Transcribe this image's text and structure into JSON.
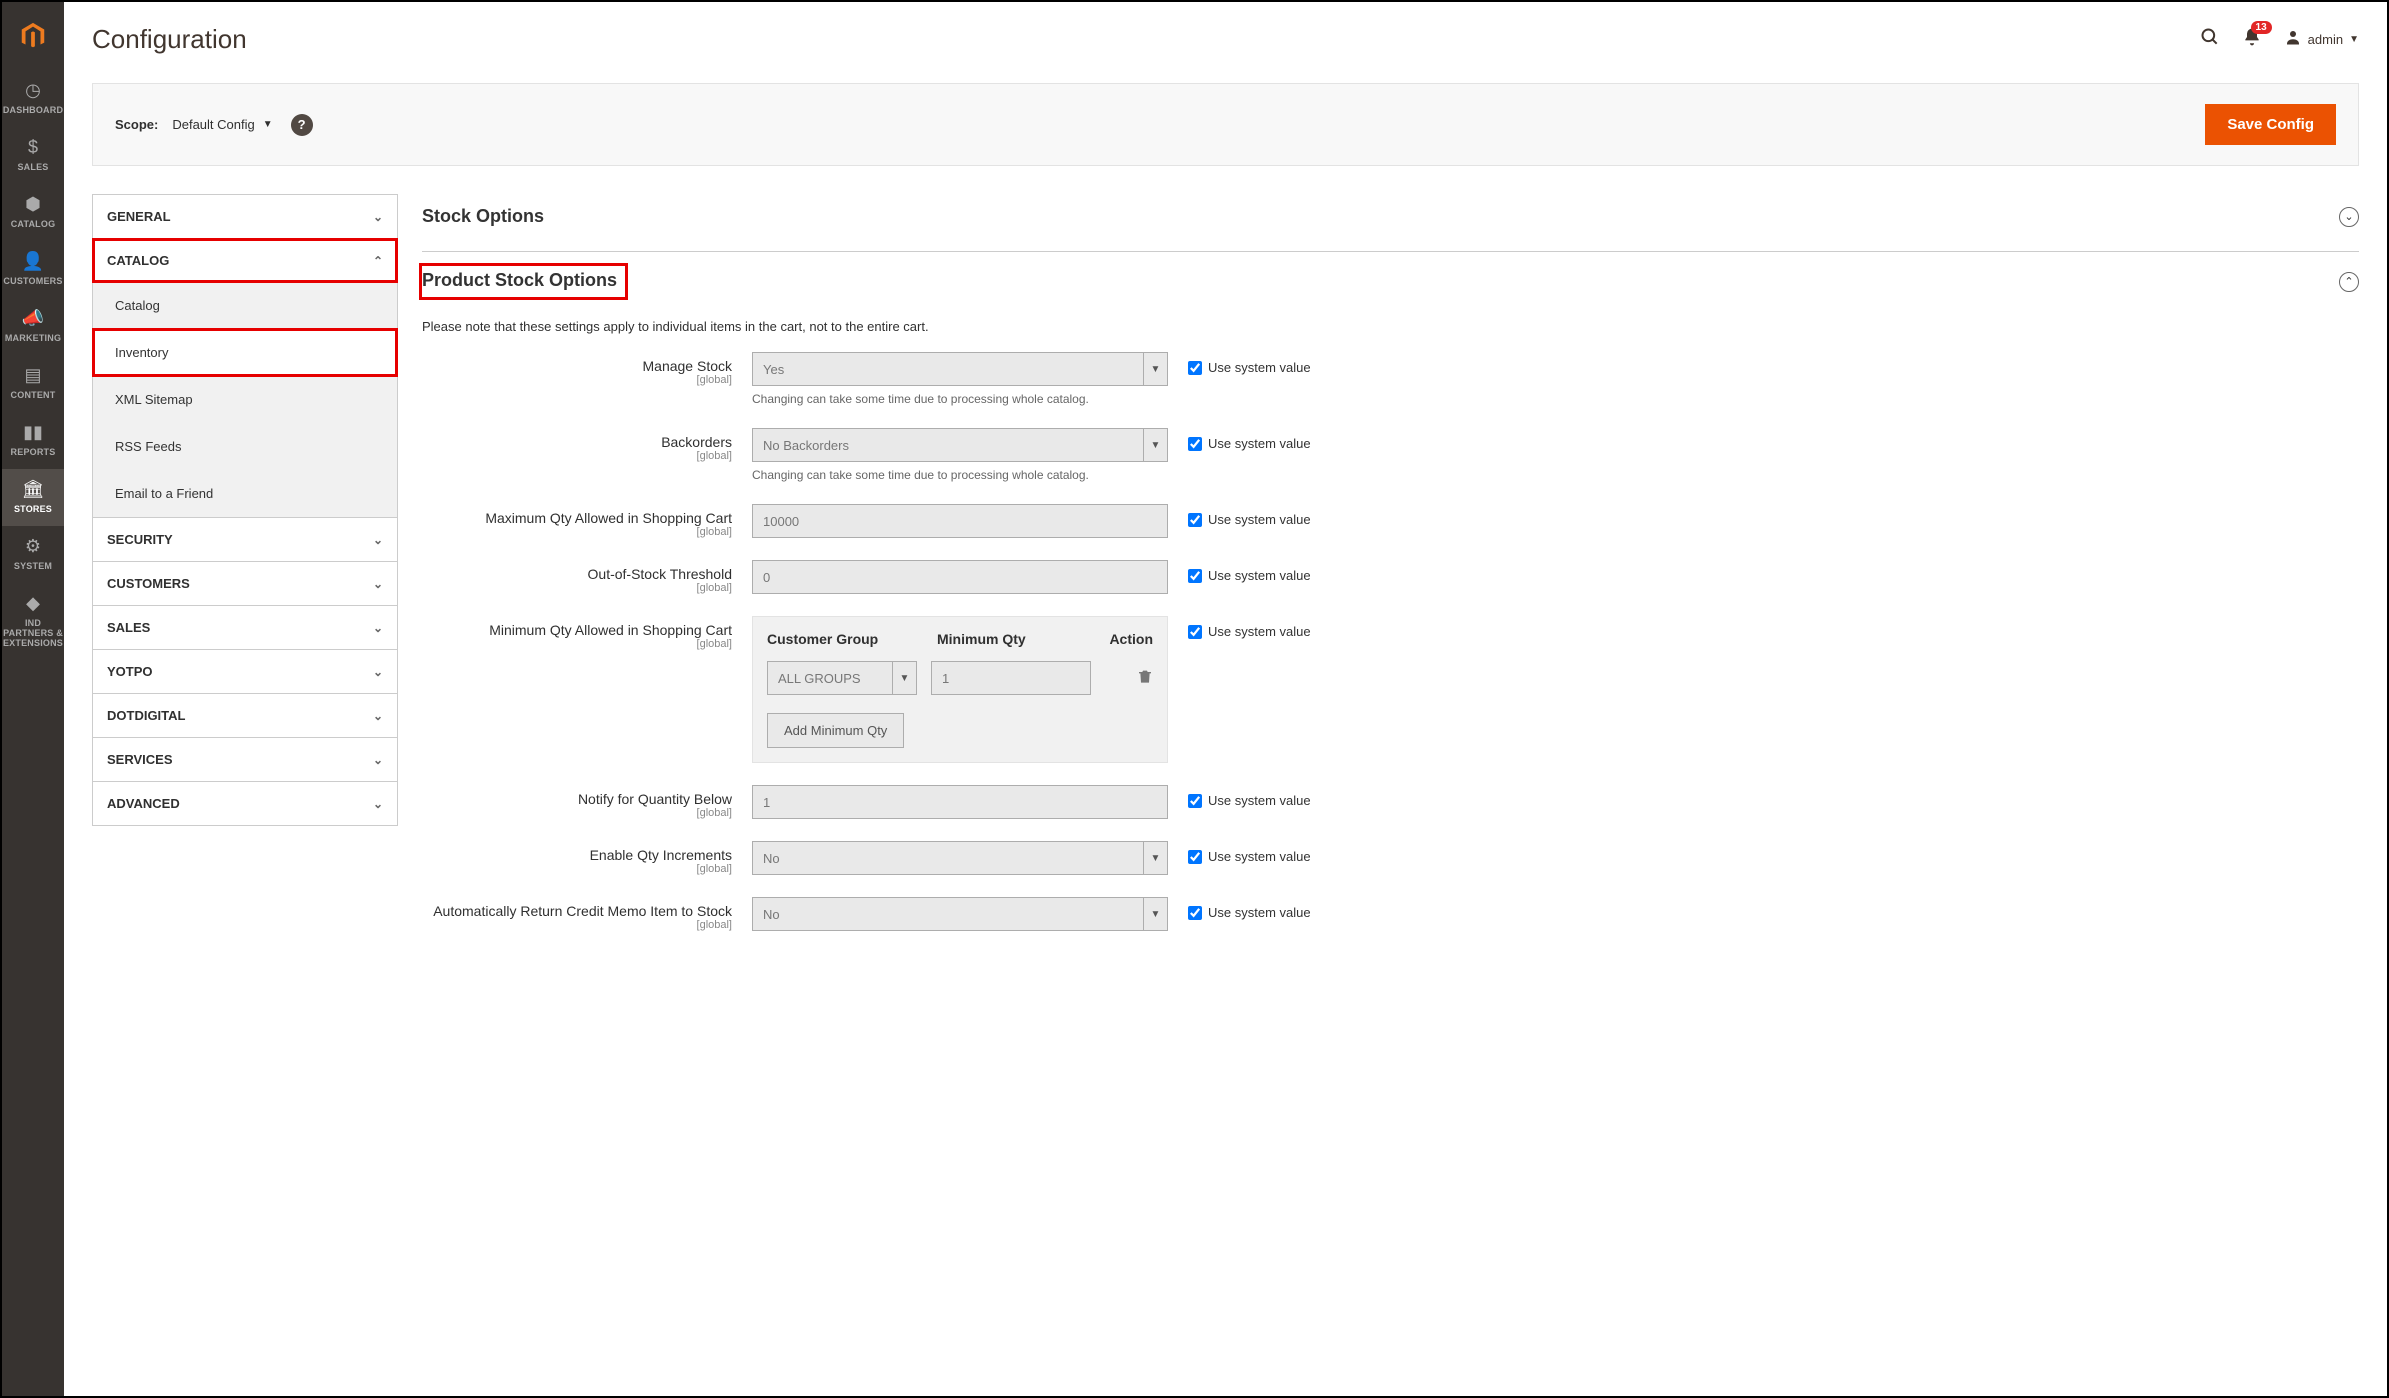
{
  "page": {
    "title": "Configuration"
  },
  "topbar": {
    "notifications_count": "13",
    "username": "admin"
  },
  "scopebar": {
    "label": "Scope:",
    "selected": "Default Config",
    "save_btn": "Save Config"
  },
  "admin_menu": [
    {
      "icon": "◷",
      "label": "DASHBOARD"
    },
    {
      "icon": "$",
      "label": "SALES"
    },
    {
      "icon": "⬢",
      "label": "CATALOG"
    },
    {
      "icon": "👤",
      "label": "CUSTOMERS"
    },
    {
      "icon": "📣",
      "label": "MARKETING"
    },
    {
      "icon": "▤",
      "label": "CONTENT"
    },
    {
      "icon": "▮▮",
      "label": "REPORTS"
    },
    {
      "icon": "🏛",
      "label": "STORES"
    },
    {
      "icon": "⚙",
      "label": "SYSTEM"
    },
    {
      "icon": "◆",
      "label": "IND PARTNERS & EXTENSIONS"
    }
  ],
  "cfgnav": {
    "groups": [
      {
        "label": "GENERAL",
        "expanded": false
      },
      {
        "label": "CATALOG",
        "expanded": true,
        "highlight": true,
        "items": [
          {
            "label": "Catalog"
          },
          {
            "label": "Inventory",
            "active": true,
            "highlight": true
          },
          {
            "label": "XML Sitemap"
          },
          {
            "label": "RSS Feeds"
          },
          {
            "label": "Email to a Friend"
          }
        ]
      },
      {
        "label": "SECURITY",
        "expanded": false
      },
      {
        "label": "CUSTOMERS",
        "expanded": false
      },
      {
        "label": "SALES",
        "expanded": false
      },
      {
        "label": "YOTPO",
        "expanded": false
      },
      {
        "label": "DOTDIGITAL",
        "expanded": false
      },
      {
        "label": "SERVICES",
        "expanded": false
      },
      {
        "label": "ADVANCED",
        "expanded": false
      }
    ]
  },
  "sections": {
    "stock_options": {
      "title": "Stock Options"
    },
    "product_stock_options": {
      "title": "Product Stock Options",
      "note": "Please note that these settings apply to individual items in the cart, not to the entire cart.",
      "use_system_label": "Use system value",
      "global_scope": "[global]",
      "fields": {
        "manage_stock": {
          "label": "Manage Stock",
          "value": "Yes",
          "hint": "Changing can take some time due to processing whole catalog."
        },
        "backorders": {
          "label": "Backorders",
          "value": "No Backorders",
          "hint": "Changing can take some time due to processing whole catalog."
        },
        "max_qty": {
          "label": "Maximum Qty Allowed in Shopping Cart",
          "value": "10000"
        },
        "oos_threshold": {
          "label": "Out-of-Stock Threshold",
          "value": "0"
        },
        "min_qty": {
          "label": "Minimum Qty Allowed in Shopping Cart",
          "table": {
            "head": {
              "c1": "Customer Group",
              "c2": "Minimum Qty",
              "c3": "Action"
            },
            "row": {
              "group": "ALL GROUPS",
              "qty": "1"
            },
            "add_btn": "Add Minimum Qty"
          }
        },
        "notify_below": {
          "label": "Notify for Quantity Below",
          "value": "1"
        },
        "qty_increments": {
          "label": "Enable Qty Increments",
          "value": "No"
        },
        "auto_return": {
          "label": "Automatically Return Credit Memo Item to Stock",
          "value": "No"
        }
      }
    }
  }
}
